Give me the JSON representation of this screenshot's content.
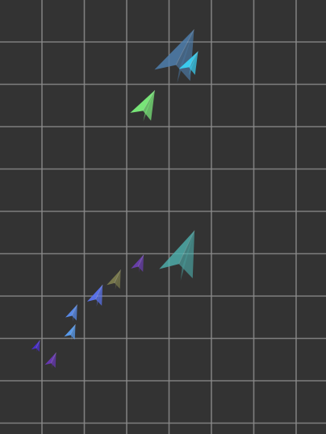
{
  "scene": {
    "background": "#333333",
    "grid_color": "#8c8c8c",
    "grid_visible": true,
    "grid_cell": "square"
  },
  "planes": [
    {
      "name": "plane-steel-blue",
      "color": "#4f7fae",
      "opacity": 0.85,
      "heading": -18
    },
    {
      "name": "plane-cyan",
      "color": "#3ad1f4",
      "opacity": 0.95,
      "heading": -15
    },
    {
      "name": "plane-green",
      "color": "#7cef7c",
      "opacity": 0.95,
      "heading": -15
    },
    {
      "name": "plane-teal",
      "color": "#4fb3b0",
      "opacity": 0.8,
      "heading": -20
    },
    {
      "name": "plane-purple",
      "color": "#6b3fb0",
      "opacity": 0.95,
      "heading": -20
    },
    {
      "name": "plane-olive",
      "color": "#80804f",
      "opacity": 0.9,
      "heading": -20
    },
    {
      "name": "plane-periwinkle",
      "color": "#5b74f0",
      "opacity": 0.95,
      "heading": -20
    },
    {
      "name": "plane-light-blue-1",
      "color": "#5a8ef0",
      "opacity": 0.95,
      "heading": -20
    },
    {
      "name": "plane-light-blue-2",
      "color": "#5aa0f5",
      "opacity": 0.95,
      "heading": -20
    },
    {
      "name": "plane-indigo",
      "color": "#4b2ed6",
      "opacity": 0.95,
      "heading": -20
    },
    {
      "name": "plane-violet",
      "color": "#6a38b8",
      "opacity": 0.95,
      "heading": -20
    }
  ]
}
